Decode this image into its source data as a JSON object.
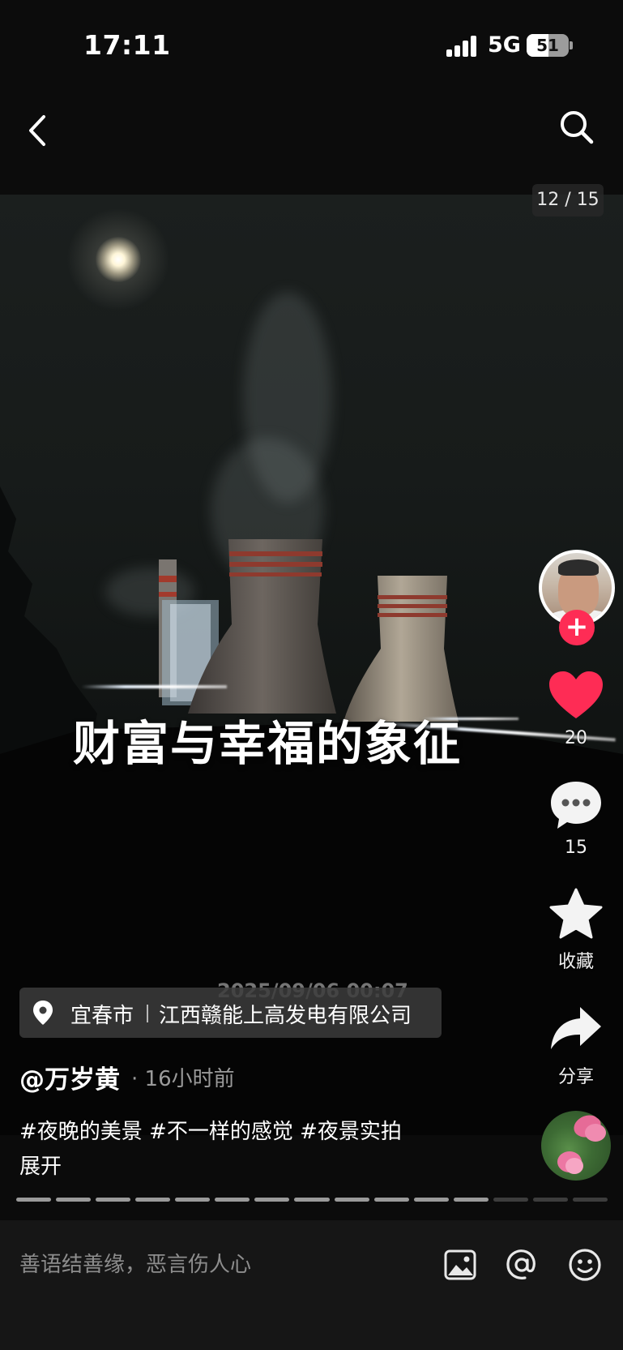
{
  "status_bar": {
    "time": "17:11",
    "network": "5G",
    "battery": "51"
  },
  "nav": {
    "back_icon": "chevron-left-icon",
    "search_icon": "search-icon"
  },
  "media": {
    "page_indicator": "12 / 15",
    "overlay_title": "财富与幸福的象征",
    "timestamp": "2025/09/06 00:07"
  },
  "actions": {
    "like_count": "20",
    "comment_count": "15",
    "favorite_label": "收藏",
    "share_label": "分享",
    "accent_color": "#fe2c55"
  },
  "location": {
    "city": "宜春市",
    "place": "江西赣能上高发电有限公司"
  },
  "post": {
    "author": "@万岁黄",
    "posted_time": "· 16小时前",
    "caption": "#夜晚的美景 #不一样的感觉 #夜景实拍",
    "expand_label": "展开"
  },
  "progress": {
    "total": 15,
    "current": 12
  },
  "comment_bar": {
    "placeholder": "善语结善缘，恶言伤人心"
  }
}
